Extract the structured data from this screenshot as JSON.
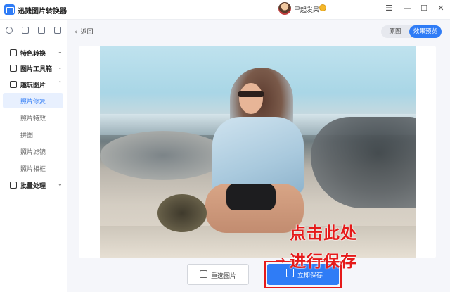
{
  "app": {
    "title": "迅捷图片转换器"
  },
  "user": {
    "name": "早起发呆"
  },
  "window_controls": {
    "menu": "☰",
    "minimize": "—",
    "maximize": "☐",
    "close": "✕"
  },
  "sidebar": {
    "groups": [
      {
        "label": "特色转换",
        "chevron": "⌄"
      },
      {
        "label": "图片工具箱",
        "chevron": "⌄"
      },
      {
        "label": "趣玩图片",
        "chevron": "⌃"
      },
      {
        "label": "批量处理",
        "chevron": "⌄"
      }
    ],
    "sub_items": [
      {
        "label": "照片修复",
        "active": true
      },
      {
        "label": "照片特效",
        "active": false
      },
      {
        "label": "拼图",
        "active": false
      },
      {
        "label": "照片滤镜",
        "active": false
      },
      {
        "label": "照片相框",
        "active": false
      }
    ]
  },
  "main": {
    "back_label": "返回",
    "back_icon": "‹",
    "toggle": {
      "original": "原图",
      "effect": "效果预览",
      "selected": "效果预览"
    }
  },
  "actions": {
    "reselect_label": "重选图片",
    "save_label": "立即保存"
  },
  "annotation": {
    "line1": "点击此处",
    "line2": "进行保存",
    "arrow": "→",
    "color": "#e51a1a"
  },
  "colors": {
    "accent": "#2f7cf6",
    "highlight": "#e51a1a"
  }
}
